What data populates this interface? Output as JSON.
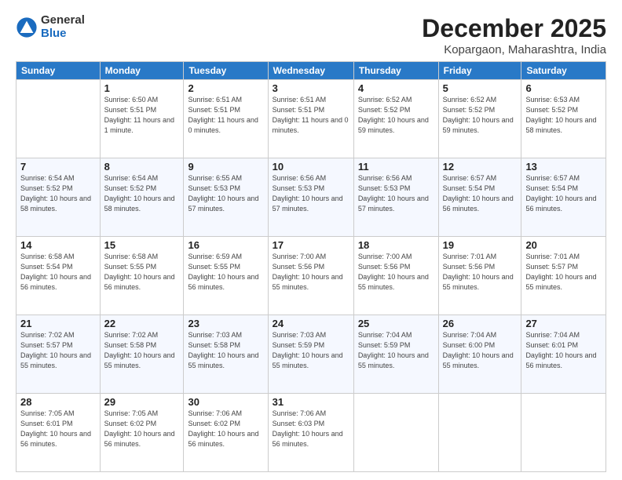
{
  "logo": {
    "general": "General",
    "blue": "Blue"
  },
  "title": "December 2025",
  "location": "Kopargaon, Maharashtra, India",
  "days_header": [
    "Sunday",
    "Monday",
    "Tuesday",
    "Wednesday",
    "Thursday",
    "Friday",
    "Saturday"
  ],
  "weeks": [
    [
      {
        "day": "",
        "sunrise": "",
        "sunset": "",
        "daylight": ""
      },
      {
        "day": "1",
        "sunrise": "Sunrise: 6:50 AM",
        "sunset": "Sunset: 5:51 PM",
        "daylight": "Daylight: 11 hours and 1 minute."
      },
      {
        "day": "2",
        "sunrise": "Sunrise: 6:51 AM",
        "sunset": "Sunset: 5:51 PM",
        "daylight": "Daylight: 11 hours and 0 minutes."
      },
      {
        "day": "3",
        "sunrise": "Sunrise: 6:51 AM",
        "sunset": "Sunset: 5:51 PM",
        "daylight": "Daylight: 11 hours and 0 minutes."
      },
      {
        "day": "4",
        "sunrise": "Sunrise: 6:52 AM",
        "sunset": "Sunset: 5:52 PM",
        "daylight": "Daylight: 10 hours and 59 minutes."
      },
      {
        "day": "5",
        "sunrise": "Sunrise: 6:52 AM",
        "sunset": "Sunset: 5:52 PM",
        "daylight": "Daylight: 10 hours and 59 minutes."
      },
      {
        "day": "6",
        "sunrise": "Sunrise: 6:53 AM",
        "sunset": "Sunset: 5:52 PM",
        "daylight": "Daylight: 10 hours and 58 minutes."
      }
    ],
    [
      {
        "day": "7",
        "sunrise": "Sunrise: 6:54 AM",
        "sunset": "Sunset: 5:52 PM",
        "daylight": "Daylight: 10 hours and 58 minutes."
      },
      {
        "day": "8",
        "sunrise": "Sunrise: 6:54 AM",
        "sunset": "Sunset: 5:52 PM",
        "daylight": "Daylight: 10 hours and 58 minutes."
      },
      {
        "day": "9",
        "sunrise": "Sunrise: 6:55 AM",
        "sunset": "Sunset: 5:53 PM",
        "daylight": "Daylight: 10 hours and 57 minutes."
      },
      {
        "day": "10",
        "sunrise": "Sunrise: 6:56 AM",
        "sunset": "Sunset: 5:53 PM",
        "daylight": "Daylight: 10 hours and 57 minutes."
      },
      {
        "day": "11",
        "sunrise": "Sunrise: 6:56 AM",
        "sunset": "Sunset: 5:53 PM",
        "daylight": "Daylight: 10 hours and 57 minutes."
      },
      {
        "day": "12",
        "sunrise": "Sunrise: 6:57 AM",
        "sunset": "Sunset: 5:54 PM",
        "daylight": "Daylight: 10 hours and 56 minutes."
      },
      {
        "day": "13",
        "sunrise": "Sunrise: 6:57 AM",
        "sunset": "Sunset: 5:54 PM",
        "daylight": "Daylight: 10 hours and 56 minutes."
      }
    ],
    [
      {
        "day": "14",
        "sunrise": "Sunrise: 6:58 AM",
        "sunset": "Sunset: 5:54 PM",
        "daylight": "Daylight: 10 hours and 56 minutes."
      },
      {
        "day": "15",
        "sunrise": "Sunrise: 6:58 AM",
        "sunset": "Sunset: 5:55 PM",
        "daylight": "Daylight: 10 hours and 56 minutes."
      },
      {
        "day": "16",
        "sunrise": "Sunrise: 6:59 AM",
        "sunset": "Sunset: 5:55 PM",
        "daylight": "Daylight: 10 hours and 56 minutes."
      },
      {
        "day": "17",
        "sunrise": "Sunrise: 7:00 AM",
        "sunset": "Sunset: 5:56 PM",
        "daylight": "Daylight: 10 hours and 55 minutes."
      },
      {
        "day": "18",
        "sunrise": "Sunrise: 7:00 AM",
        "sunset": "Sunset: 5:56 PM",
        "daylight": "Daylight: 10 hours and 55 minutes."
      },
      {
        "day": "19",
        "sunrise": "Sunrise: 7:01 AM",
        "sunset": "Sunset: 5:56 PM",
        "daylight": "Daylight: 10 hours and 55 minutes."
      },
      {
        "day": "20",
        "sunrise": "Sunrise: 7:01 AM",
        "sunset": "Sunset: 5:57 PM",
        "daylight": "Daylight: 10 hours and 55 minutes."
      }
    ],
    [
      {
        "day": "21",
        "sunrise": "Sunrise: 7:02 AM",
        "sunset": "Sunset: 5:57 PM",
        "daylight": "Daylight: 10 hours and 55 minutes."
      },
      {
        "day": "22",
        "sunrise": "Sunrise: 7:02 AM",
        "sunset": "Sunset: 5:58 PM",
        "daylight": "Daylight: 10 hours and 55 minutes."
      },
      {
        "day": "23",
        "sunrise": "Sunrise: 7:03 AM",
        "sunset": "Sunset: 5:58 PM",
        "daylight": "Daylight: 10 hours and 55 minutes."
      },
      {
        "day": "24",
        "sunrise": "Sunrise: 7:03 AM",
        "sunset": "Sunset: 5:59 PM",
        "daylight": "Daylight: 10 hours and 55 minutes."
      },
      {
        "day": "25",
        "sunrise": "Sunrise: 7:04 AM",
        "sunset": "Sunset: 5:59 PM",
        "daylight": "Daylight: 10 hours and 55 minutes."
      },
      {
        "day": "26",
        "sunrise": "Sunrise: 7:04 AM",
        "sunset": "Sunset: 6:00 PM",
        "daylight": "Daylight: 10 hours and 55 minutes."
      },
      {
        "day": "27",
        "sunrise": "Sunrise: 7:04 AM",
        "sunset": "Sunset: 6:01 PM",
        "daylight": "Daylight: 10 hours and 56 minutes."
      }
    ],
    [
      {
        "day": "28",
        "sunrise": "Sunrise: 7:05 AM",
        "sunset": "Sunset: 6:01 PM",
        "daylight": "Daylight: 10 hours and 56 minutes."
      },
      {
        "day": "29",
        "sunrise": "Sunrise: 7:05 AM",
        "sunset": "Sunset: 6:02 PM",
        "daylight": "Daylight: 10 hours and 56 minutes."
      },
      {
        "day": "30",
        "sunrise": "Sunrise: 7:06 AM",
        "sunset": "Sunset: 6:02 PM",
        "daylight": "Daylight: 10 hours and 56 minutes."
      },
      {
        "day": "31",
        "sunrise": "Sunrise: 7:06 AM",
        "sunset": "Sunset: 6:03 PM",
        "daylight": "Daylight: 10 hours and 56 minutes."
      },
      {
        "day": "",
        "sunrise": "",
        "sunset": "",
        "daylight": ""
      },
      {
        "day": "",
        "sunrise": "",
        "sunset": "",
        "daylight": ""
      },
      {
        "day": "",
        "sunrise": "",
        "sunset": "",
        "daylight": ""
      }
    ]
  ]
}
